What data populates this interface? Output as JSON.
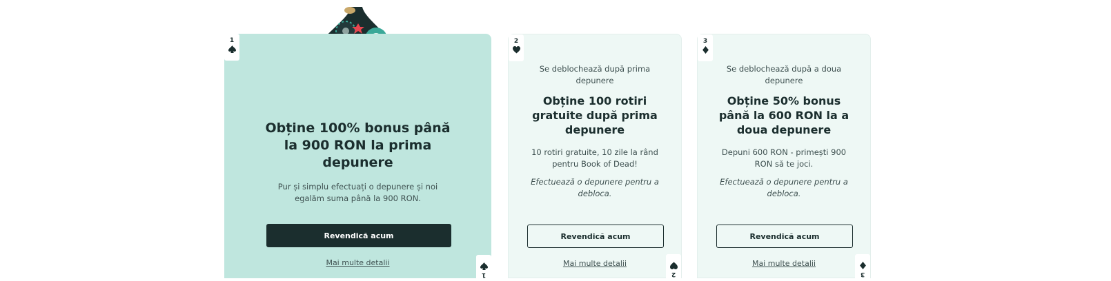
{
  "cards": [
    {
      "rank": "1",
      "suit_icon": "spade-icon",
      "title": "Obține 100% bonus până la 900 RON la prima depunere",
      "description": "Pur și simplu efectuați o depunere și noi egalăm suma până la 900 RON.",
      "button_label": "Revendică acum",
      "details_link": "Mai multe detalii"
    },
    {
      "rank": "2",
      "suit_icon": "heart-icon",
      "unlock_text": "Se deblochează după prima depunere",
      "title": "Obține 100 rotiri gratuite după prima depunere",
      "description": "10 rotiri gratuite, 10 zile la rând pentru Book of Dead!",
      "note": "Efectuează o depunere pentru a debloca.",
      "button_label": "Revendică acum",
      "details_link": "Mai multe detalii"
    },
    {
      "rank": "3",
      "suit_icon": "diamond-icon",
      "unlock_text": "Se deblochează după a doua depunere",
      "title": "Obține 50% bonus până la 600 RON la a doua depunere",
      "description": "Depuni 600 RON - primești 900 RON să te joci.",
      "note": "Efectuează o depunere pentru a debloca.",
      "button_label": "Revendică acum",
      "details_link": "Mai multe detalii"
    }
  ],
  "colors": {
    "active_card_bg": "#bfe6de",
    "locked_card_bg": "#eef8f5",
    "dark": "#1b2e2e",
    "accent_red": "#e8454f",
    "chip_teal": "#3aa898",
    "coin_gold": "#c9a86a"
  },
  "hero_icon": "spade-chips-illustration-icon"
}
